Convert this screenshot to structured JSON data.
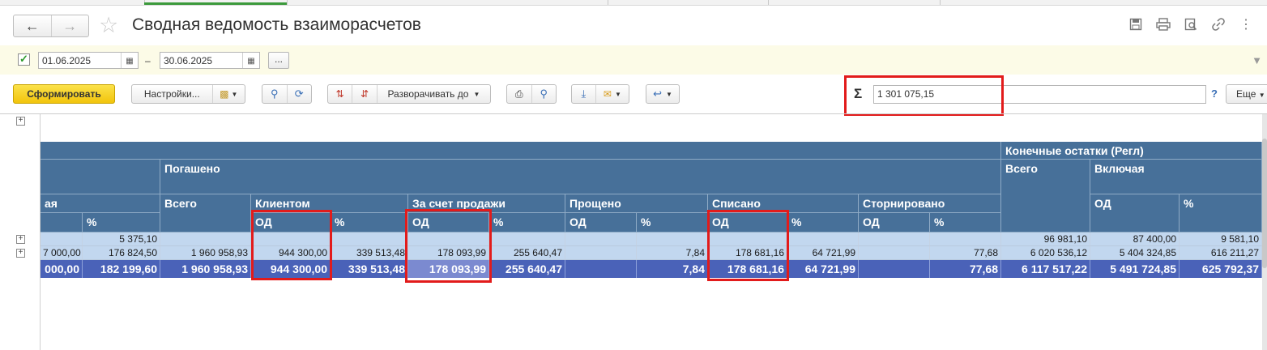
{
  "window": {
    "title": "Сводная ведомость взаиморасчетов"
  },
  "filters": {
    "enabled": true,
    "date_from": "01.06.2025",
    "date_sep": "–",
    "date_to": "30.06.2025",
    "more_label": "..."
  },
  "toolbar": {
    "generate_label": "Сформировать",
    "settings_label": "Настройки...",
    "expand_label": "Разворачивать до",
    "sum_symbol": "Σ",
    "sum_value": "1 301 075,15",
    "help_label": "?",
    "more_label": "Еще"
  },
  "report": {
    "headers": {
      "final_balances": "Конечные остатки (Регл)",
      "paid_off": "Погашено",
      "total": "Всего",
      "including": "Включая",
      "left_truncated": "ая",
      "total_sub": "Всего",
      "by_client": "Клиентом",
      "by_sale": "За счет продажи",
      "forgiven": "Прощено",
      "written_off": "Списано",
      "reversed": "Сторнировано",
      "od": "ОД",
      "pct": "%"
    },
    "row1": {
      "c1": "5 375,10",
      "f_total": "96 981,10",
      "f_od": "87 400,00",
      "f_pct": "9 581,10"
    },
    "row2": {
      "c0": "7 000,00",
      "c1": "176 824,50",
      "total": "1 960 958,93",
      "client_od": "944 300,00",
      "client_pct": "339 513,48",
      "sale_od": "178 093,99",
      "sale_pct": "255 640,47",
      "forg_pct": "7,84",
      "wo_od": "178 681,16",
      "wo_pct": "64 721,99",
      "rev_pct": "77,68",
      "f_total": "6 020 536,12",
      "f_od": "5 404 324,85",
      "f_pct": "616 211,27"
    },
    "totals": {
      "c0": "000,00",
      "c1": "182 199,60",
      "total": "1 960 958,93",
      "client_od": "944 300,00",
      "client_pct": "339 513,48",
      "sale_od": "178 093,99",
      "sale_pct": "255 640,47",
      "forg_pct": "7,84",
      "wo_od": "178 681,16",
      "wo_pct": "64 721,99",
      "rev_pct": "77,68",
      "f_total": "6 117 517,22",
      "f_od": "5 491 724,85",
      "f_pct": "625 792,37"
    }
  },
  "colors": {
    "header_bg": "#477099",
    "row_bg": "#c2d7ef",
    "total_bg": "#4a62b8",
    "highlight": "#e21b1b",
    "generate_bg": "#f2c40c"
  }
}
